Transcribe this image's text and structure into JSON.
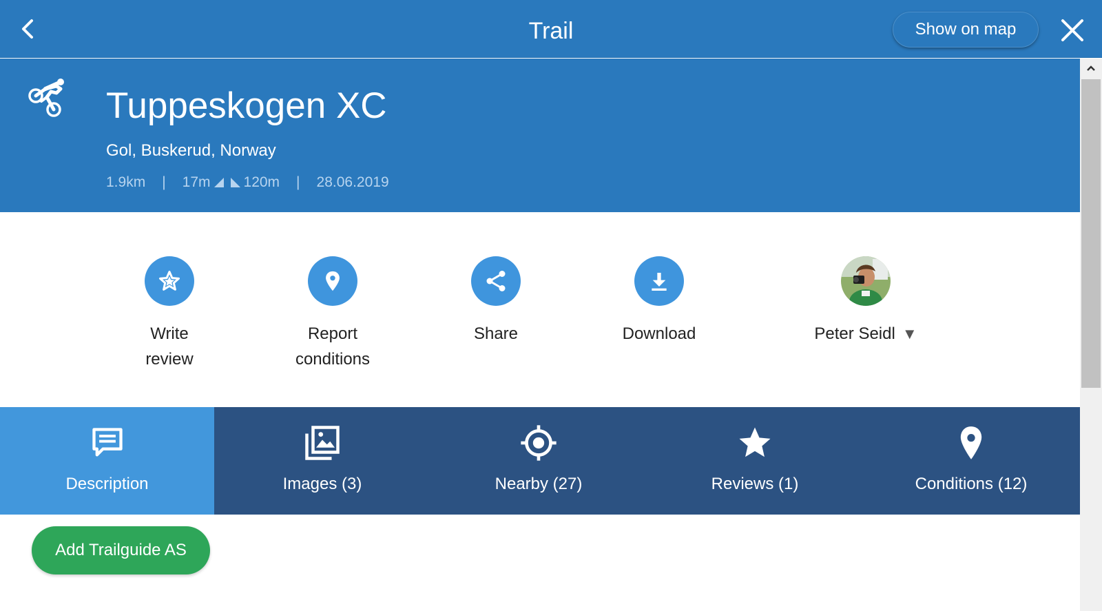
{
  "topbar": {
    "title": "Trail",
    "show_map_label": "Show on map",
    "back_icon": "chevron-left-icon",
    "close_icon": "close-icon"
  },
  "trail": {
    "name": "Tuppeskogen XC",
    "location": "Gol, Buskerud, Norway",
    "distance": "1.9km",
    "ascent": "17m",
    "descent": "120m",
    "date": "28.06.2019",
    "separator": "|",
    "activity_icon": "mountain-bike-icon"
  },
  "actions": [
    {
      "label": "Write review",
      "icon": "star-outline-icon"
    },
    {
      "label": "Report conditions",
      "icon": "map-pin-icon"
    },
    {
      "label": "Share",
      "icon": "share-icon"
    },
    {
      "label": "Download",
      "icon": "download-icon"
    }
  ],
  "user": {
    "name": "Peter Seidl",
    "dropdown_glyph": "▼"
  },
  "tabs": [
    {
      "label": "Description",
      "icon": "comment-icon",
      "active": true
    },
    {
      "label": "Images (3)",
      "icon": "images-icon",
      "active": false
    },
    {
      "label": "Nearby (27)",
      "icon": "crosshair-icon",
      "active": false
    },
    {
      "label": "Reviews (1)",
      "icon": "star-icon",
      "active": false
    },
    {
      "label": "Conditions (12)",
      "icon": "map-pin-icon",
      "active": false
    }
  ],
  "content": {
    "add_button_label": "Add Trailguide AS"
  },
  "colors": {
    "header_blue": "#2a79bd",
    "action_blue": "#3f95dd",
    "tab_bar": "#2c5282",
    "tab_active": "#4297dc",
    "add_green": "#2ea659"
  }
}
